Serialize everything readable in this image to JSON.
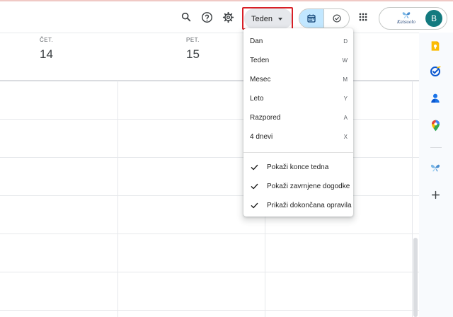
{
  "toolbar": {
    "view_selector_label": "Teden",
    "account_avatar_letter": "B",
    "org_logo_text": "Kaisuolo",
    "icons": [
      "search-icon",
      "help-icon",
      "settings-icon",
      "calendar-icon",
      "tasks-check-icon",
      "apps-grid-icon"
    ]
  },
  "calendar": {
    "days": [
      {
        "name": "ČET.",
        "number": "14"
      },
      {
        "name": "PET.",
        "number": "15"
      }
    ]
  },
  "view_menu": {
    "items": [
      {
        "label": "Dan",
        "shortcut": "D"
      },
      {
        "label": "Teden",
        "shortcut": "W"
      },
      {
        "label": "Mesec",
        "shortcut": "M"
      },
      {
        "label": "Leto",
        "shortcut": "Y"
      },
      {
        "label": "Razpored",
        "shortcut": "A"
      },
      {
        "label": "4 dnevi",
        "shortcut": "X"
      }
    ],
    "options": [
      {
        "label": "Pokaži konce tedna",
        "checked": true
      },
      {
        "label": "Pokaži zavrnjene dogodke",
        "checked": true
      },
      {
        "label": "Prikaži dokončana opravila",
        "checked": true
      }
    ]
  },
  "side_panel": {
    "icons": [
      "keep-icon",
      "tasks-icon",
      "contacts-icon",
      "maps-icon",
      "addon-icon",
      "add-icon"
    ]
  },
  "colors": {
    "accent": "#0b57d0",
    "highlight_box": "#d81f26",
    "avatar_bg": "#137a7f",
    "active_segment": "#c2e7ff"
  }
}
